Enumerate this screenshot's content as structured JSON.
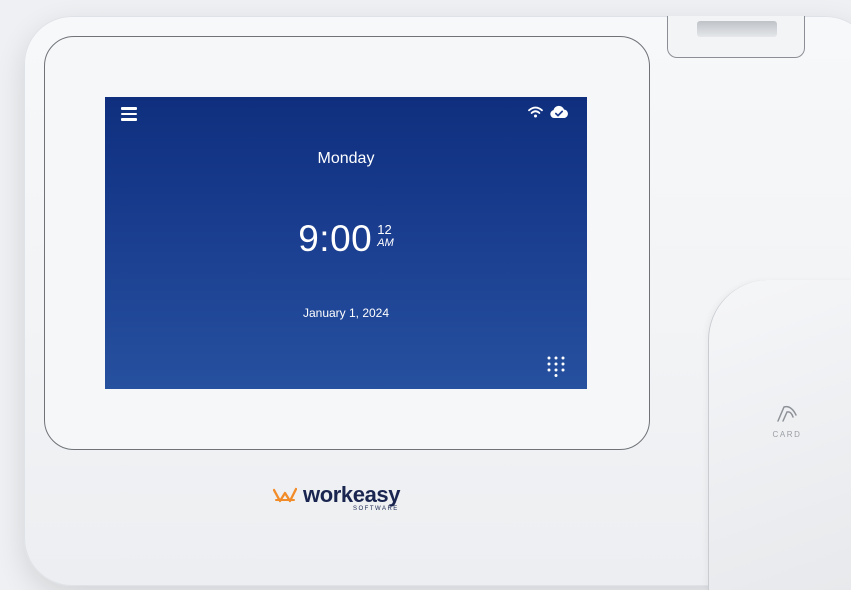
{
  "screen": {
    "day": "Monday",
    "time": "9:00",
    "seconds": "12",
    "ampm": "AM",
    "date": "January 1, 2024",
    "status_icons": [
      "wifi-icon",
      "cloud-check-icon"
    ],
    "menu_icon": "hamburger-menu-icon",
    "keypad_icon": "keypad-icon"
  },
  "card_reader": {
    "label": "CARD"
  },
  "brand": {
    "name": "workeasy",
    "subtitle": "SOFTWARE",
    "accent_color": "#f28c28",
    "text_color": "#1a2650"
  },
  "colors": {
    "screen_top": "#0f2f7e",
    "screen_bottom": "#26519f"
  }
}
